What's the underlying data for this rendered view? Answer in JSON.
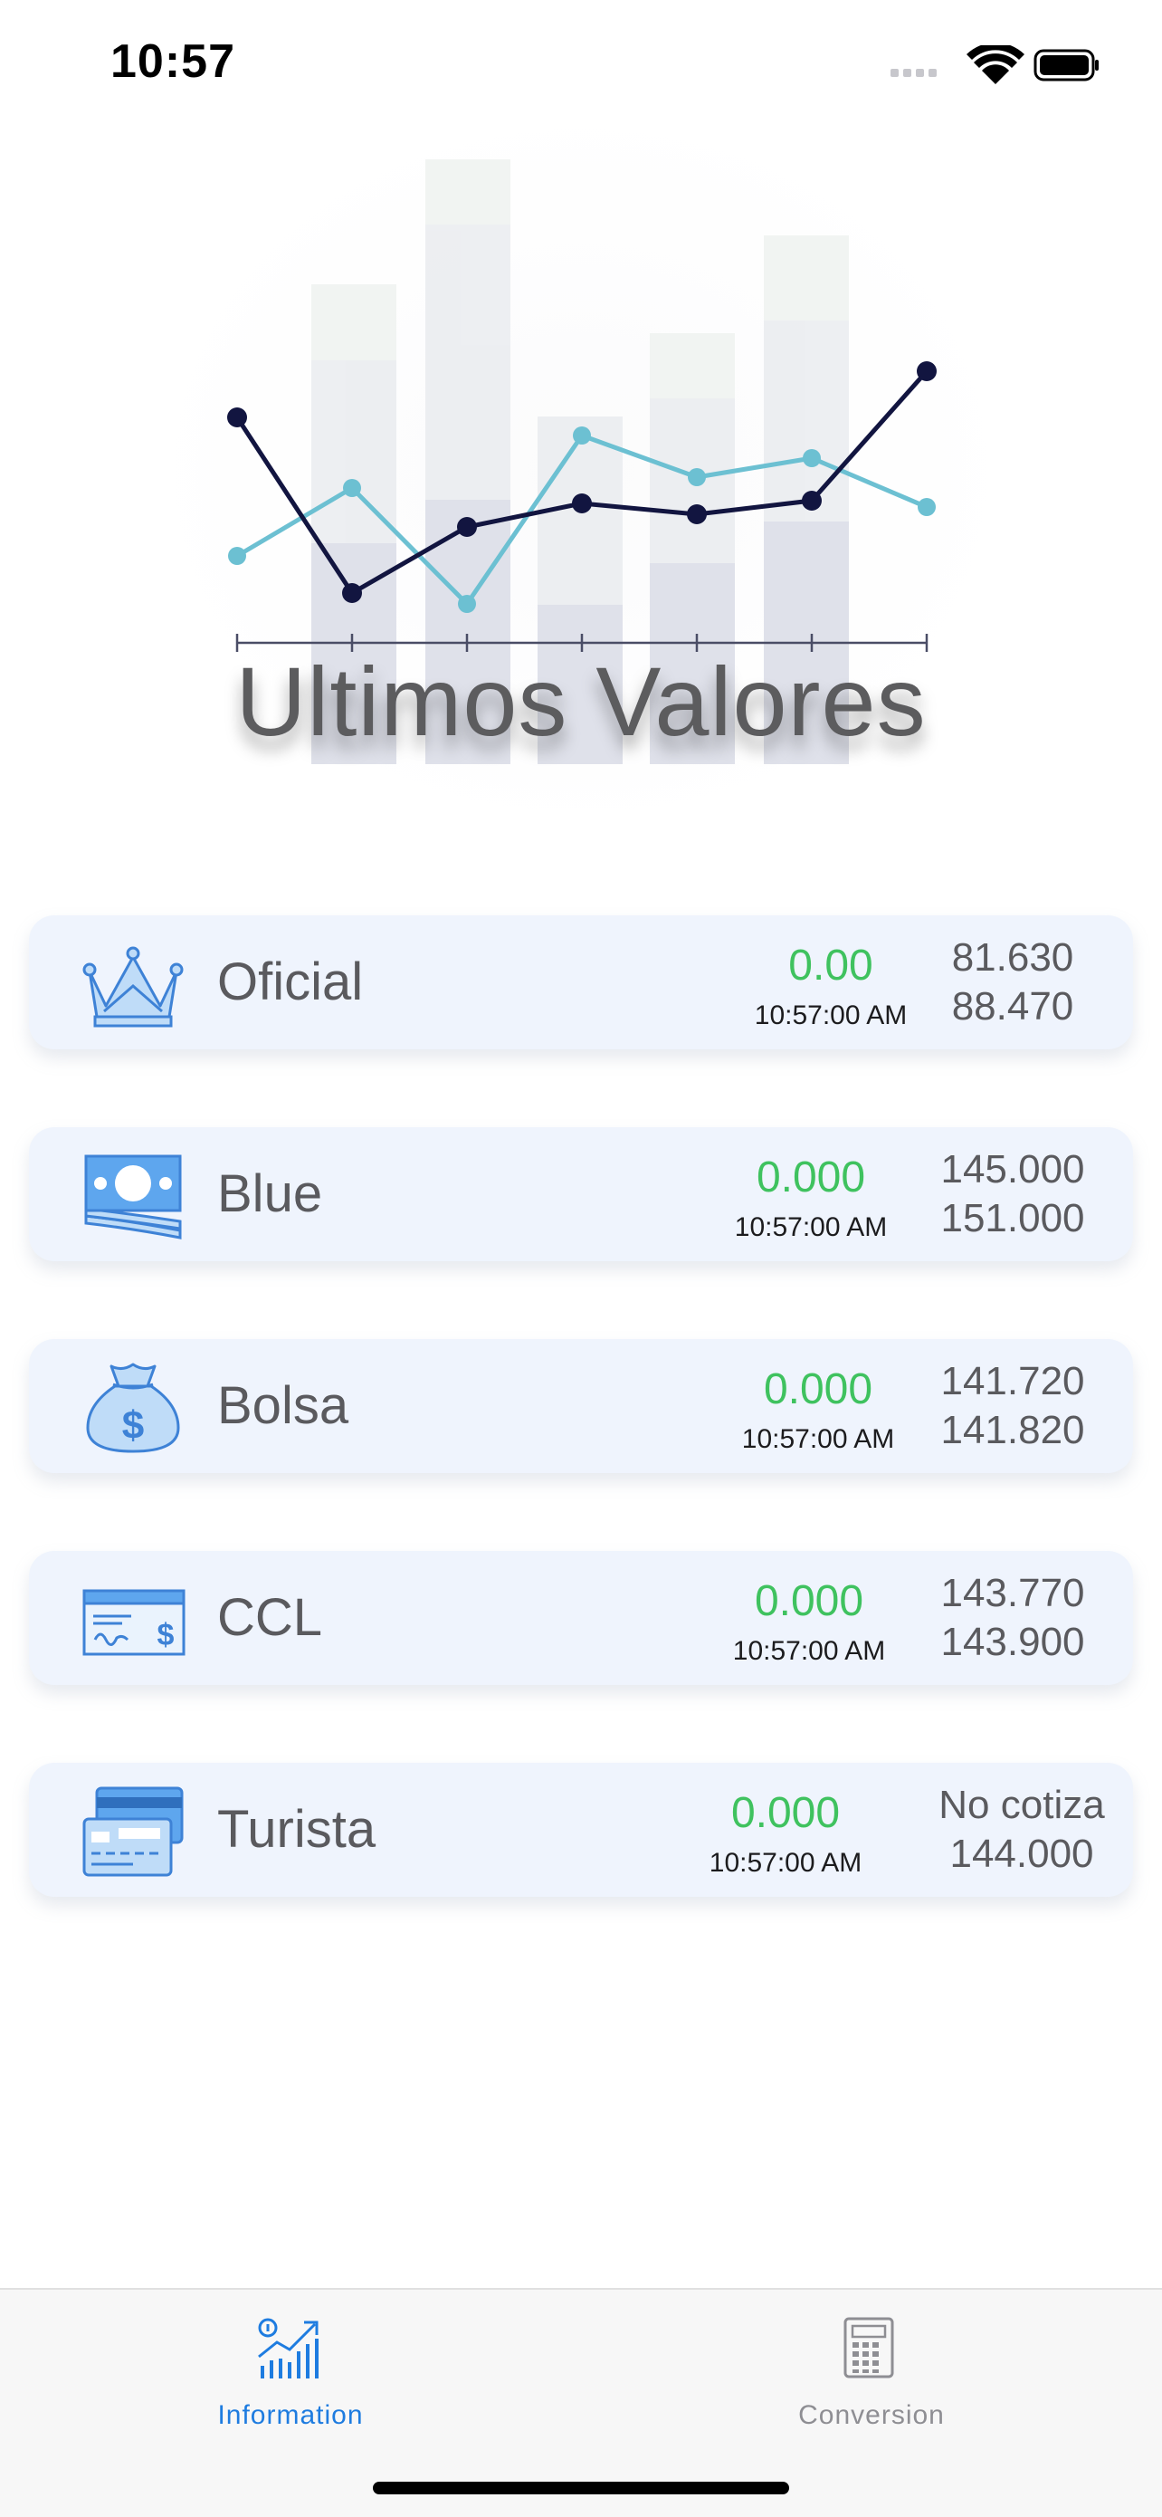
{
  "status_bar": {
    "time": "10:57"
  },
  "hero": {
    "title": "Ultimos Valores"
  },
  "rates": [
    {
      "id": "oficial",
      "name": "Oficial",
      "icon": "crown-icon",
      "change": "0.00",
      "time": "10:57:00 AM",
      "buy": "81.630",
      "sell": "88.470"
    },
    {
      "id": "blue",
      "name": "Blue",
      "icon": "banknotes-icon",
      "change": "0.000",
      "time": "10:57:00 AM",
      "buy": "145.000",
      "sell": "151.000"
    },
    {
      "id": "bolsa",
      "name": "Bolsa",
      "icon": "money-bag-icon",
      "change": "0.000",
      "time": "10:57:00 AM",
      "buy": "141.720",
      "sell": "141.820"
    },
    {
      "id": "ccl",
      "name": "CCL",
      "icon": "check-icon",
      "change": "0.000",
      "time": "10:57:00 AM",
      "buy": "143.770",
      "sell": "143.900"
    },
    {
      "id": "turista",
      "name": "Turista",
      "icon": "credit-cards-icon",
      "change": "0.000",
      "time": "10:57:00 AM",
      "buy": "No cotiza",
      "sell": "144.000"
    }
  ],
  "tab_bar": {
    "tabs": [
      {
        "label": "Information",
        "icon": "chart-icon",
        "active": true
      },
      {
        "label": "Conversion",
        "icon": "calculator-icon",
        "active": false
      }
    ]
  },
  "colors": {
    "accent": "#1e7ce0",
    "positive": "#3fc25f",
    "card_bg": "#eff4fd",
    "series_dark": "#121540",
    "series_light": "#6cc0d2"
  }
}
